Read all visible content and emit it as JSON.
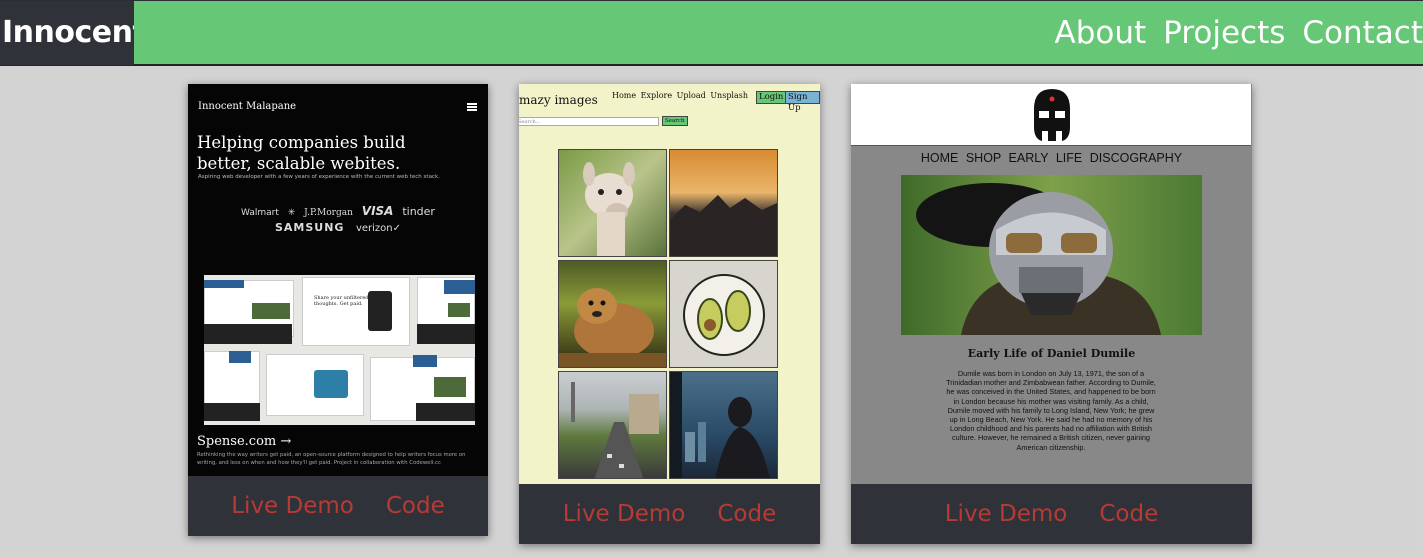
{
  "nav": {
    "brand": "Innocent",
    "links": [
      "About",
      "Projects",
      "Contact"
    ]
  },
  "colors": {
    "nav_bg": "#66c777",
    "brand_bg": "#30323a",
    "card_bg": "#30323a",
    "action_text": "#b83a34",
    "page_bg": "#d3d3d3"
  },
  "projects": [
    {
      "preview": {
        "site_name": "Innocent Malapane",
        "menu_icon": "hamburger-icon",
        "headline": "Helping companies build better, scalable webites.",
        "subline": "Aspiring web developer with a few years of experience with the current web tech stack.",
        "logos_row1": [
          "Walmart ✳",
          "J.P.Morgan",
          "VISA",
          "tinder"
        ],
        "logos_row2": [
          "SAMSUNG",
          "verizon✓"
        ],
        "mock_title": "Share your unfiltered thoughts. Get paid.",
        "project_title": "Spense.com →",
        "project_desc": "Rethinking the way writers get paid, an open-source platform designed to help writers focus more on writing, and less on when and how they'll get paid. Project in collaboration with Codewell.cc"
      },
      "live_demo": "Live Demo",
      "code": "Code"
    },
    {
      "preview": {
        "logo": "mazy images",
        "links": [
          "Home",
          "Explore",
          "Upload",
          "Unsplash"
        ],
        "login": "Login",
        "signup": "Sign Up",
        "search_placeholder": "Search...",
        "search_button": "Search",
        "tiles": [
          "alpaca",
          "mountain-sunset",
          "dog",
          "avocado",
          "city-street",
          "window-silhouette"
        ]
      },
      "live_demo": "Live Demo",
      "code": "Code"
    },
    {
      "preview": {
        "logo_icon": "mask-icon",
        "menu": [
          "HOME",
          "SHOP",
          "EARLY LIFE",
          "DISCOGRAPHY"
        ],
        "heading": "Early Life of Daniel Dumile",
        "bio": "Dumile was born in London on July 13, 1971, the son of a Trinidadian mother and Zimbabwean father. According to Dumile, he was conceived in the United States, and happened to be born in London because his mother was visiting family. As a child, Dumile moved with his family to Long Island, New York; he grew up in Long Beach, New York. He said he had no memory of his London childhood and his parents had no affiliation with British culture. However, he remained a British citizen, never gaining American citizenship."
      },
      "live_demo": "Live Demo",
      "code": "Code"
    }
  ]
}
